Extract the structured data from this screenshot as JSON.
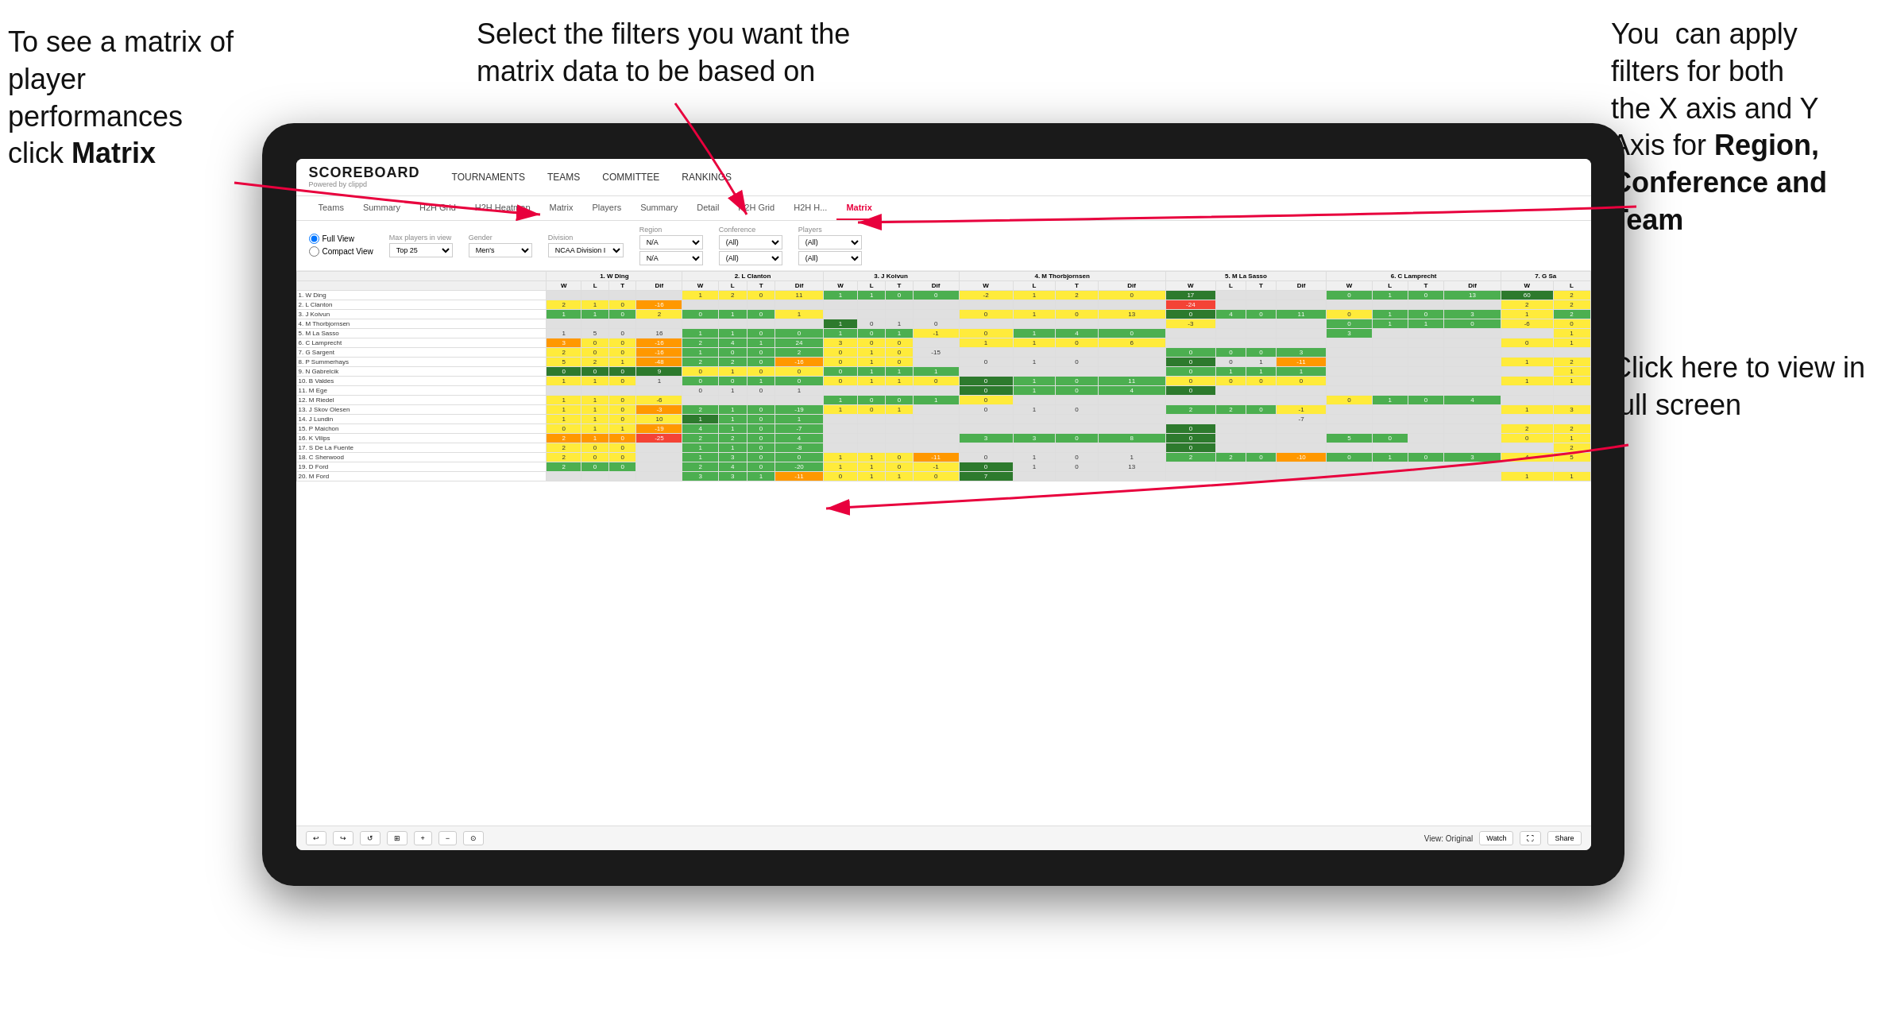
{
  "annotations": {
    "left": {
      "line1": "To see a matrix of",
      "line2": "player performances",
      "line3_plain": "click ",
      "line3_bold": "Matrix"
    },
    "center": {
      "text": "Select the filters you want the matrix data to be based on"
    },
    "right_top": {
      "line1": "You  can apply",
      "line2": "filters for both",
      "line3": "the X axis and Y",
      "line4_plain": "Axis for ",
      "line4_bold": "Region,",
      "line5_bold": "Conference and",
      "line6_bold": "Team"
    },
    "right_bottom": {
      "text": "Click here to view in full screen"
    }
  },
  "app": {
    "brand": "SCOREBOARD",
    "powered_by": "Powered by clippd",
    "nav": [
      "TOURNAMENTS",
      "TEAMS",
      "COMMITTEE",
      "RANKINGS"
    ],
    "sub_nav": [
      "Teams",
      "Summary",
      "H2H Grid",
      "H2H Heatmap",
      "Matrix",
      "Players",
      "Summary",
      "Detail",
      "H2H Grid",
      "H2H H...",
      "Matrix"
    ],
    "active_tab": "Matrix"
  },
  "filters": {
    "view_options": [
      "Full View",
      "Compact View"
    ],
    "max_players_label": "Max players in view",
    "max_players_value": "Top 25",
    "gender_label": "Gender",
    "gender_value": "Men's",
    "division_label": "Division",
    "division_value": "NCAA Division I",
    "region_label": "Region",
    "region_value": "N/A",
    "conference_label": "Conference",
    "conference_values": [
      "(All)",
      "(All)"
    ],
    "players_label": "Players",
    "players_values": [
      "(All)",
      "(All)"
    ]
  },
  "matrix": {
    "col_headers": [
      "1. W Ding",
      "2. L Clanton",
      "3. J Koivun",
      "4. M Thorbjornsen",
      "5. M La Sasso",
      "6. C Lamprecht",
      "7. G Sa"
    ],
    "sub_headers": [
      "W",
      "L",
      "T",
      "Dif"
    ],
    "rows": [
      {
        "name": "1. W Ding",
        "cells": "row1"
      },
      {
        "name": "2. L Clanton",
        "cells": "row2"
      },
      {
        "name": "3. J Koivun",
        "cells": "row3"
      },
      {
        "name": "4. M Thorbjornsen",
        "cells": "row4"
      },
      {
        "name": "5. M La Sasso",
        "cells": "row5"
      },
      {
        "name": "6. C Lamprecht",
        "cells": "row6"
      },
      {
        "name": "7. G Sargent",
        "cells": "row7"
      },
      {
        "name": "8. P Summerhays",
        "cells": "row8"
      },
      {
        "name": "9. N Gabrelcik",
        "cells": "row9"
      },
      {
        "name": "10. B Valdes",
        "cells": "row10"
      },
      {
        "name": "11. M Ege",
        "cells": "row11"
      },
      {
        "name": "12. M Riedel",
        "cells": "row12"
      },
      {
        "name": "13. J Skov Olesen",
        "cells": "row13"
      },
      {
        "name": "14. J Lundin",
        "cells": "row14"
      },
      {
        "name": "15. P Maichon",
        "cells": "row15"
      },
      {
        "name": "16. K Vilips",
        "cells": "row16"
      },
      {
        "name": "17. S De La Fuente",
        "cells": "row17"
      },
      {
        "name": "18. C Sherwood",
        "cells": "row18"
      },
      {
        "name": "19. D Ford",
        "cells": "row19"
      },
      {
        "name": "20. M Ford",
        "cells": "row20"
      }
    ]
  },
  "footer": {
    "view_label": "View: Original",
    "watch_label": "Watch",
    "share_label": "Share"
  }
}
